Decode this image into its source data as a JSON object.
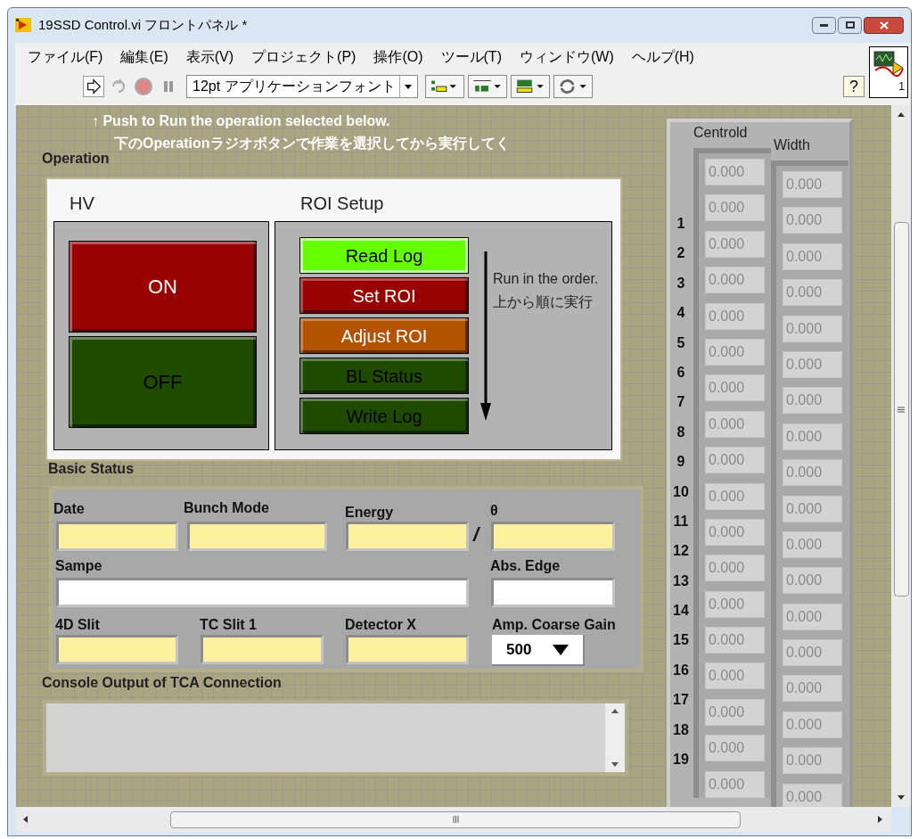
{
  "window": {
    "title": "19SSD Control.vi フロントパネル *"
  },
  "menu": [
    {
      "label": "ファイル(F)"
    },
    {
      "label": "編集(E)"
    },
    {
      "label": "表示(V)"
    },
    {
      "label": "プロジェクト(P)"
    },
    {
      "label": "操作(O)"
    },
    {
      "label": "ツール(T)"
    },
    {
      "label": "ウィンドウ(W)"
    },
    {
      "label": "ヘルプ(H)"
    }
  ],
  "toolbar": {
    "font": "12pt アプリケーションフォント",
    "help": "?",
    "vi_icon_number": "1"
  },
  "run_hint": "↑ Push to Run the operation selected below.",
  "run_hint_jp": "下のOperationラジオボタンで作業を選択してから実行してく",
  "operation": {
    "label": "Operation",
    "hv": {
      "label": "HV",
      "buttons": [
        {
          "label": "ON",
          "color": "#990000"
        },
        {
          "label": "OFF",
          "color": "#1f4a00"
        }
      ]
    },
    "roi_setup": {
      "label": "ROI Setup",
      "options": [
        {
          "label": "Read Log",
          "color": "#66ff00",
          "selected": true
        },
        {
          "label": "Set ROI",
          "color": "#990000",
          "selected": false
        },
        {
          "label": "Adjust ROI",
          "color": "#b35200",
          "selected": false
        },
        {
          "label": "BL Status",
          "color": "#1f4a00",
          "selected": false
        },
        {
          "label": "Write Log",
          "color": "#1f4a00",
          "selected": false
        }
      ],
      "note": [
        "Run in the order.",
        "上から順に実行"
      ]
    }
  },
  "basic_status": {
    "label": "Basic Status",
    "separator": "/",
    "fields": [
      {
        "label": "Date",
        "kind": "indicator"
      },
      {
        "label": "Bunch Mode",
        "kind": "indicator"
      },
      {
        "label": "Energy",
        "kind": "indicator"
      },
      {
        "label": "θ",
        "kind": "indicator"
      },
      {
        "label": "Sampe",
        "kind": "control"
      },
      {
        "label": "Abs. Edge",
        "kind": "control"
      },
      {
        "label": "4D Slit",
        "kind": "indicator"
      },
      {
        "label": "TC Slit 1",
        "kind": "indicator"
      },
      {
        "label": "Detector X",
        "kind": "indicator"
      },
      {
        "label": "Amp. Coarse Gain",
        "kind": "dropdown",
        "value": "500"
      }
    ]
  },
  "console": {
    "label": "Console Output of TCA Connection"
  },
  "arrays": {
    "indices": [
      "1",
      "2",
      "3",
      "4",
      "5",
      "6",
      "7",
      "8",
      "9",
      "10",
      "11",
      "12",
      "13",
      "14",
      "15",
      "16",
      "17",
      "18",
      "19"
    ],
    "centroid": {
      "label": "Centrold",
      "values": [
        "0.000",
        "0.000",
        "0.000",
        "0.000",
        "0.000",
        "0.000",
        "0.000",
        "0.000",
        "0.000",
        "0.000",
        "0.000",
        "0.000",
        "0.000",
        "0.000",
        "0.000",
        "0.000",
        "0.000",
        "0.000"
      ]
    },
    "width": {
      "label": "Width",
      "values": [
        "0.000",
        "0.000",
        "0.000",
        "0.000",
        "0.000",
        "0.000",
        "0.000",
        "0.000",
        "0.000",
        "0.000",
        "0.000",
        "0.000",
        "0.000",
        "0.000",
        "0.000",
        "0.000",
        "0.000",
        "0.000"
      ]
    }
  }
}
